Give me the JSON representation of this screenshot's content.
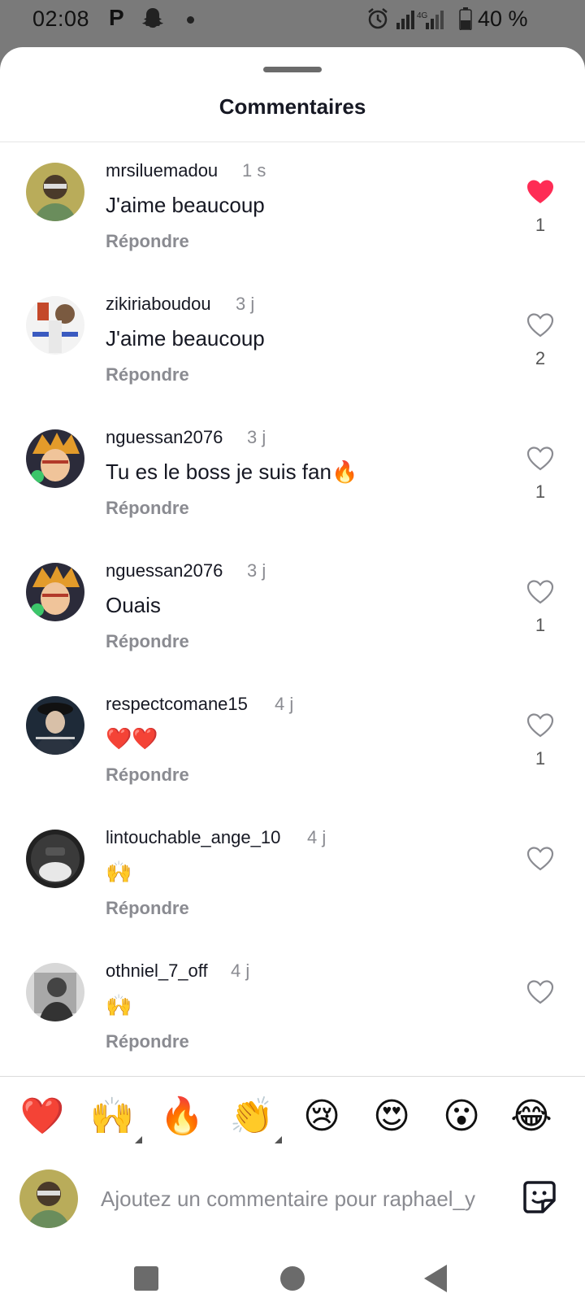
{
  "status_bar": {
    "time": "02:08",
    "p_icon": "P",
    "battery_percent": "40 %",
    "icons": [
      "parking-icon",
      "snapchat-ghost-icon",
      "alarm-icon",
      "signal-4g-icon",
      "battery-icon"
    ]
  },
  "sheet": {
    "title": "Commentaires"
  },
  "comments": [
    {
      "username": "mrsiluemadou",
      "time": "1 s",
      "text": "J'aime beaucoup",
      "reply": "Répondre",
      "likes": "1",
      "liked": true
    },
    {
      "username": "zikiriaboudou",
      "time": "3 j",
      "text": "J'aime beaucoup",
      "reply": "Répondre",
      "likes": "2",
      "liked": false
    },
    {
      "username": "nguessan2076",
      "time": "3 j",
      "text": "Tu es le boss je suis fan🔥",
      "reply": "Répondre",
      "likes": "1",
      "liked": false
    },
    {
      "username": "nguessan2076",
      "time": "3 j",
      "text": "Ouais",
      "reply": "Répondre",
      "likes": "1",
      "liked": false
    },
    {
      "username": "respectcomane15",
      "time": "4 j",
      "text": "❤️❤️",
      "reply": "Répondre",
      "likes": "1",
      "liked": false
    },
    {
      "username": "lintouchable_ange_10",
      "time": "4 j",
      "text": "🙌",
      "reply": "Répondre",
      "likes": "",
      "liked": false
    },
    {
      "username": "othniel_7_off",
      "time": "4 j",
      "text": "🙌",
      "reply": "Répondre",
      "likes": "",
      "liked": false
    }
  ],
  "quick_emojis": [
    "❤️",
    "🙌",
    "🔥",
    "👏",
    "😢",
    "😍",
    "😮",
    "😂"
  ],
  "composer": {
    "placeholder": "Ajoutez un commentaire pour raphael_y"
  },
  "colors": {
    "liked_heart": "#fe2c55",
    "muted_text": "#8a8b91",
    "primary_text": "#161823"
  }
}
